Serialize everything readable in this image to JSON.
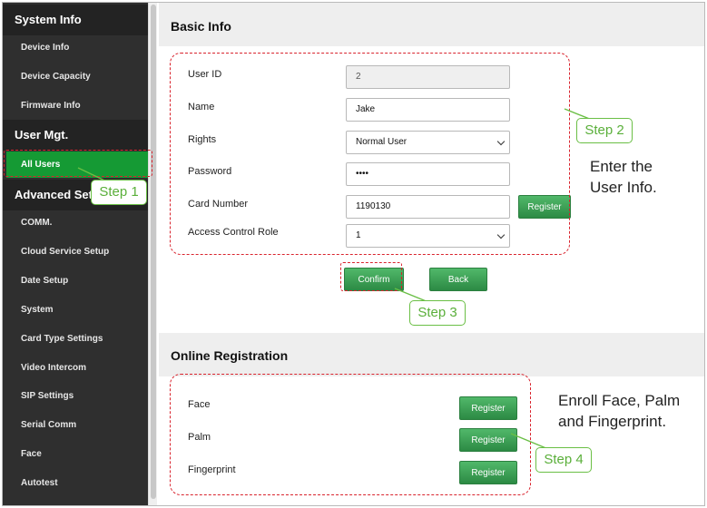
{
  "sidebar": {
    "sections": [
      {
        "title": "System Info",
        "items": [
          "Device Info",
          "Device Capacity",
          "Firmware Info"
        ]
      },
      {
        "title": "User Mgt.",
        "items": [
          "All Users"
        ]
      },
      {
        "title": "Advanced Setti",
        "items": [
          "COMM.",
          "Cloud Service Setup",
          "Date Setup",
          "System",
          "Card Type Settings",
          "Video Intercom",
          "SIP Settings",
          "Serial Comm",
          "Face",
          "Autotest"
        ]
      }
    ],
    "active_item": "All Users"
  },
  "basic_info": {
    "title": "Basic Info",
    "user_id": {
      "label": "User ID",
      "value": "2"
    },
    "name": {
      "label": "Name",
      "value": "Jake"
    },
    "rights": {
      "label": "Rights",
      "value": "Normal User"
    },
    "password": {
      "label": "Password",
      "value": "••••"
    },
    "card_number": {
      "label": "Card Number",
      "value": "1190130",
      "button": "Register"
    },
    "access_control_role": {
      "label": "Access Control Role",
      "value": "1"
    },
    "confirm_label": "Confirm",
    "back_label": "Back"
  },
  "online_registration": {
    "title": "Online Registration",
    "rows": [
      {
        "label": "Face",
        "button": "Register"
      },
      {
        "label": "Palm",
        "button": "Register"
      },
      {
        "label": "Fingerprint",
        "button": "Register"
      }
    ]
  },
  "annotations": {
    "step1": "Step 1",
    "step2": "Step 2",
    "step3": "Step 3",
    "step4": "Step 4",
    "enter_info": [
      "Enter the",
      "User Info."
    ],
    "enroll": [
      "Enroll Face, Palm",
      "and Fingerprint."
    ]
  },
  "colors": {
    "accent_green": "#159a34",
    "annotation_red": "#d9232d",
    "step_green": "#6abf45"
  }
}
